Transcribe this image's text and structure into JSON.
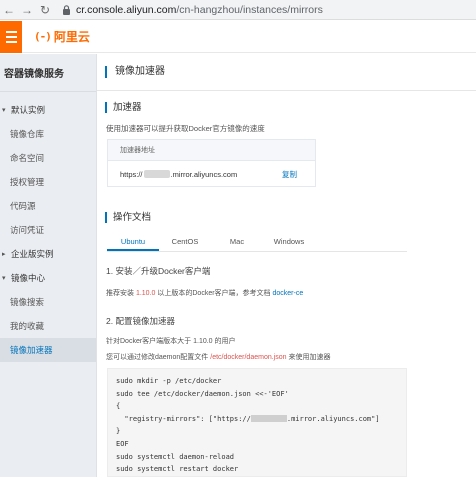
{
  "browser": {
    "url_host": "cr.console.aliyun.com",
    "url_path": "/cn-hangzhou/instances/mirrors"
  },
  "header": {
    "logo_mark": "(-)",
    "logo_text": "阿里云",
    "accent": "#ff6a00"
  },
  "sidebar": {
    "title": "容器镜像服务",
    "groups": [
      {
        "label": "默认实例",
        "items": [
          "镜像仓库",
          "命名空间",
          "授权管理",
          "代码源",
          "访问凭证"
        ]
      },
      {
        "label": "企业版实例",
        "items": []
      },
      {
        "label": "镜像中心",
        "items": [
          "镜像搜索",
          "我的收藏",
          "镜像加速器"
        ]
      }
    ],
    "active": "镜像加速器"
  },
  "main": {
    "page_title": "镜像加速器",
    "accel_title": "加速器",
    "accel_desc": "使用加速器可以提升获取Docker官方镜像的速度",
    "mirror_head": "加速器地址",
    "mirror_prefix": "https://",
    "mirror_suffix": ".mirror.aliyuncs.com",
    "copy_label": "复制",
    "docs_title": "操作文档",
    "tabs": [
      "Ubuntu",
      "CentOS",
      "Mac",
      "Windows"
    ],
    "step1_title": "1. 安装／升级Docker客户端",
    "step1_pre": "推荐安装 ",
    "step1_ver": "1.10.0",
    "step1_mid": " 以上版本的Docker客户端，参考文档 ",
    "step1_link": "docker-ce",
    "step2_title": "2. 配置镜像加速器",
    "step2_line1": "针对Docker客户端版本大于 1.10.0 的用户",
    "step2_pre": "您可以通过修改daemon配置文件 ",
    "step2_path": "/etc/docker/daemon.json",
    "step2_post": " 来使用加速器",
    "code": {
      "l1": "sudo mkdir -p /etc/docker",
      "l2": "sudo tee /etc/docker/daemon.json <<-'EOF'",
      "l3": "{",
      "l4a": "  \"registry-mirrors\": [\"https://",
      "l4b": ".mirror.aliyuncs.com\"]",
      "l5": "}",
      "l6": "EOF",
      "l7": "sudo systemctl daemon-reload",
      "l8": "sudo systemctl restart docker"
    }
  }
}
